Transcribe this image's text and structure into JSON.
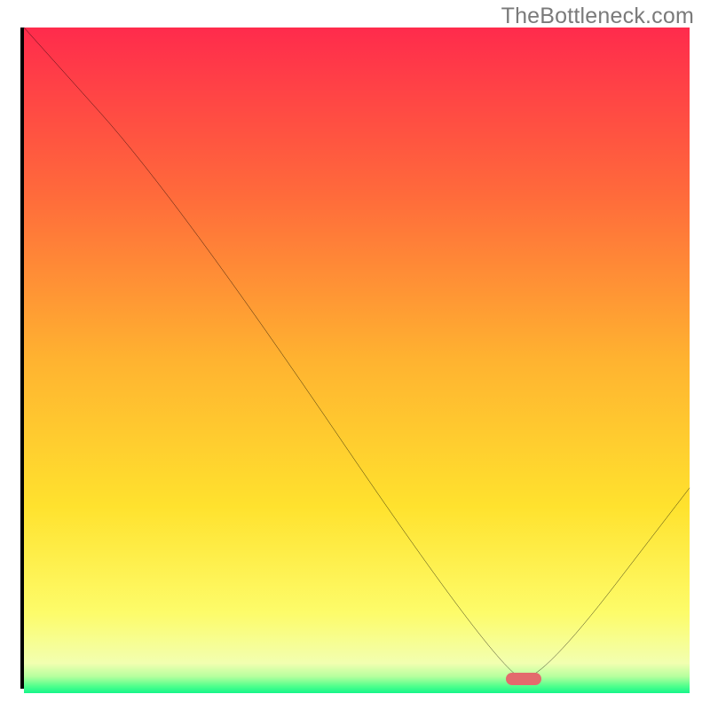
{
  "watermark": "TheBottleneck.com",
  "chart_data": {
    "type": "line",
    "title": "",
    "xlabel": "",
    "ylabel": "",
    "xlim": [
      0,
      100
    ],
    "ylim": [
      0,
      100
    ],
    "x": [
      0,
      23,
      72,
      78,
      100
    ],
    "y": [
      100,
      74,
      1,
      1,
      30
    ],
    "min_marker_x": 75,
    "min_marker_y": 1,
    "gradient_stops": [
      {
        "offset": 0,
        "color": "#ff2b4c"
      },
      {
        "offset": 0.25,
        "color": "#ff6a3b"
      },
      {
        "offset": 0.5,
        "color": "#ffb330"
      },
      {
        "offset": 0.72,
        "color": "#ffe22e"
      },
      {
        "offset": 0.88,
        "color": "#fdfc6a"
      },
      {
        "offset": 0.955,
        "color": "#f2ffb0"
      },
      {
        "offset": 0.975,
        "color": "#b6ff9e"
      },
      {
        "offset": 0.99,
        "color": "#4dff8c"
      },
      {
        "offset": 1.0,
        "color": "#15f58a"
      }
    ]
  }
}
